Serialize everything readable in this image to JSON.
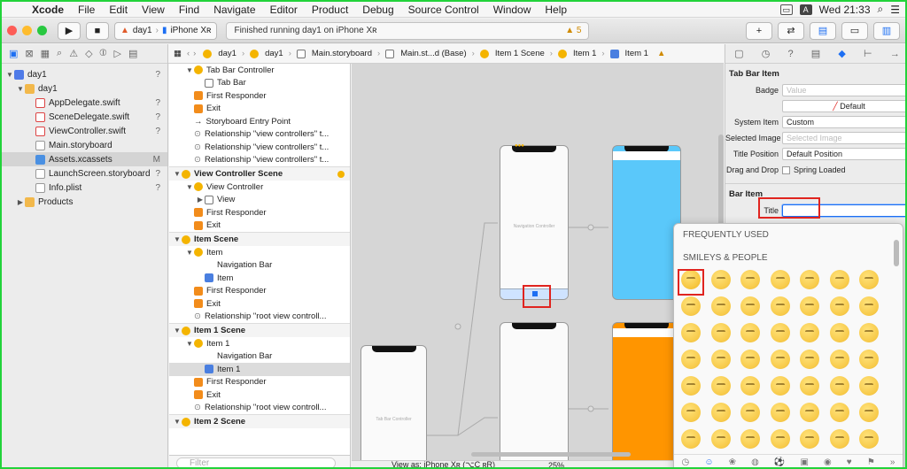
{
  "menubar": {
    "app": "Xcode",
    "items": [
      "File",
      "Edit",
      "View",
      "Find",
      "Navigate",
      "Editor",
      "Product",
      "Debug",
      "Source Control",
      "Window",
      "Help"
    ],
    "clock": "Wed 21:33",
    "user_badge": "A"
  },
  "toolbar": {
    "scheme_target": "day1",
    "scheme_device": "iPhone Xʀ",
    "status": "Finished running day1 on iPhone Xʀ",
    "warning_count": "5"
  },
  "navigator": {
    "items": [
      {
        "label": "day1",
        "marker": "?",
        "kind": "proj",
        "indent": 0,
        "expanded": true
      },
      {
        "label": "day1",
        "marker": "",
        "kind": "folder",
        "indent": 1,
        "expanded": true
      },
      {
        "label": "AppDelegate.swift",
        "marker": "?",
        "kind": "swift",
        "indent": 2
      },
      {
        "label": "SceneDelegate.swift",
        "marker": "?",
        "kind": "swift",
        "indent": 2
      },
      {
        "label": "ViewController.swift",
        "marker": "?",
        "kind": "swift",
        "indent": 2
      },
      {
        "label": "Main.storyboard",
        "marker": "",
        "kind": "board",
        "indent": 2
      },
      {
        "label": "Assets.xcassets",
        "marker": "M",
        "kind": "assets",
        "indent": 2,
        "selected": true
      },
      {
        "label": "LaunchScreen.storyboard",
        "marker": "?",
        "kind": "board",
        "indent": 2
      },
      {
        "label": "Info.plist",
        "marker": "?",
        "kind": "plist",
        "indent": 2
      },
      {
        "label": "Products",
        "marker": "",
        "kind": "folder",
        "indent": 1,
        "collapsed": true
      }
    ]
  },
  "jumpbar": {
    "crumbs": [
      "day1",
      "day1",
      "Main.storyboard",
      "Main.st...d (Base)",
      "Item 1 Scene",
      "Item 1",
      "Item 1"
    ]
  },
  "outline": {
    "rows": [
      {
        "label": "Tab Bar Controller",
        "indent": 1,
        "icon": "y",
        "tri": "▼"
      },
      {
        "label": "Tab Bar",
        "indent": 2,
        "icon": "b"
      },
      {
        "label": "First Responder",
        "indent": 1,
        "icon": "o"
      },
      {
        "label": "Exit",
        "indent": 1,
        "icon": "r"
      },
      {
        "label": "Storyboard Entry Point",
        "indent": 1,
        "icon": "arrow"
      },
      {
        "label": "Relationship \"view controllers\" t...",
        "indent": 1,
        "icon": "seg"
      },
      {
        "label": "Relationship \"view controllers\" t...",
        "indent": 1,
        "icon": "seg"
      },
      {
        "label": "Relationship \"view controllers\" t...",
        "indent": 1,
        "icon": "seg"
      },
      {
        "label": "View Controller Scene",
        "header": true,
        "badge": true
      },
      {
        "label": "View Controller",
        "indent": 1,
        "icon": "y",
        "tri": "▼"
      },
      {
        "label": "View",
        "indent": 2,
        "icon": "b",
        "tri": "▶"
      },
      {
        "label": "First Responder",
        "indent": 1,
        "icon": "o"
      },
      {
        "label": "Exit",
        "indent": 1,
        "icon": "r"
      },
      {
        "label": "Item Scene",
        "header": true
      },
      {
        "label": "Item",
        "indent": 1,
        "icon": "y",
        "tri": "▼"
      },
      {
        "label": "Navigation Bar",
        "indent": 2,
        "icon": "none"
      },
      {
        "label": "Item",
        "indent": 2,
        "icon": "s"
      },
      {
        "label": "First Responder",
        "indent": 1,
        "icon": "o"
      },
      {
        "label": "Exit",
        "indent": 1,
        "icon": "r"
      },
      {
        "label": "Relationship \"root view controll...",
        "indent": 1,
        "icon": "seg"
      },
      {
        "label": "Item 1 Scene",
        "header": true
      },
      {
        "label": "Item 1",
        "indent": 1,
        "icon": "y",
        "tri": "▼"
      },
      {
        "label": "Navigation Bar",
        "indent": 2,
        "icon": "none"
      },
      {
        "label": "Item 1",
        "indent": 2,
        "icon": "s",
        "selected": true
      },
      {
        "label": "First Responder",
        "indent": 1,
        "icon": "o"
      },
      {
        "label": "Exit",
        "indent": 1,
        "icon": "r"
      },
      {
        "label": "Relationship \"root view controll...",
        "indent": 1,
        "icon": "seg"
      },
      {
        "label": "Item 2 Scene",
        "header": true
      }
    ],
    "filter_placeholder": "Filter"
  },
  "canvas": {
    "nav_controller_label": "Navigation Controller",
    "tab_bar_controller_label": "Tab Bar Controller",
    "view_as": "View as: iPhone Xʀ (⌥C ʀR)",
    "zoom": "25%"
  },
  "inspector": {
    "section_tab_bar_item": "Tab Bar Item",
    "badge_label": "Badge",
    "badge_placeholder": "Value",
    "default_value": "Default",
    "system_item_label": "System Item",
    "system_item_value": "Custom",
    "selected_image_label": "Selected Image",
    "selected_image_placeholder": "Selected Image",
    "title_position_label": "Title Position",
    "title_position_value": "Default Position",
    "drag_drop_label": "Drag and Drop",
    "spring_loaded_label": "Spring Loaded",
    "section_bar_item": "Bar Item",
    "title_label": "Title",
    "title_value": ""
  },
  "emoji_picker": {
    "frequently_used": "FREQUENTLY USED",
    "smileys_people": "SMILEYS & PEOPLE",
    "colors": [
      "#f6c43a",
      "#f7c948",
      "#f7c948",
      "#f7c948",
      "#f7c948",
      "#f7c948",
      "#f7c948",
      "#f7c948",
      "#f7c948",
      "#f7c948",
      "#f7c948",
      "#f7c948",
      "#f7c948",
      "#f7c948",
      "#f7c948",
      "#f7c948",
      "#f7c948",
      "#f7c948",
      "#f7c948",
      "#f7c948",
      "#f7c948",
      "#f7c948",
      "#f7c948",
      "#f7c948",
      "#f7c948",
      "#f7c948",
      "#f7c948",
      "#f7c948",
      "#f7c948",
      "#f7c948",
      "#f7c948",
      "#f7c948",
      "#f7c948",
      "#f7c948",
      "#f7c948",
      "#f7c948",
      "#f7c948",
      "#f7c948",
      "#f7c948",
      "#f7c948",
      "#f7c948",
      "#f7c948",
      "#f7c948",
      "#f7c948",
      "#f7c948",
      "#f7c948",
      "#f7c948",
      "#f7c948",
      "#f7c948"
    ],
    "bottom_tabs": [
      "clock",
      "smiley",
      "animal",
      "food",
      "sport",
      "travel",
      "object",
      "symbol",
      "flag",
      "more"
    ]
  }
}
